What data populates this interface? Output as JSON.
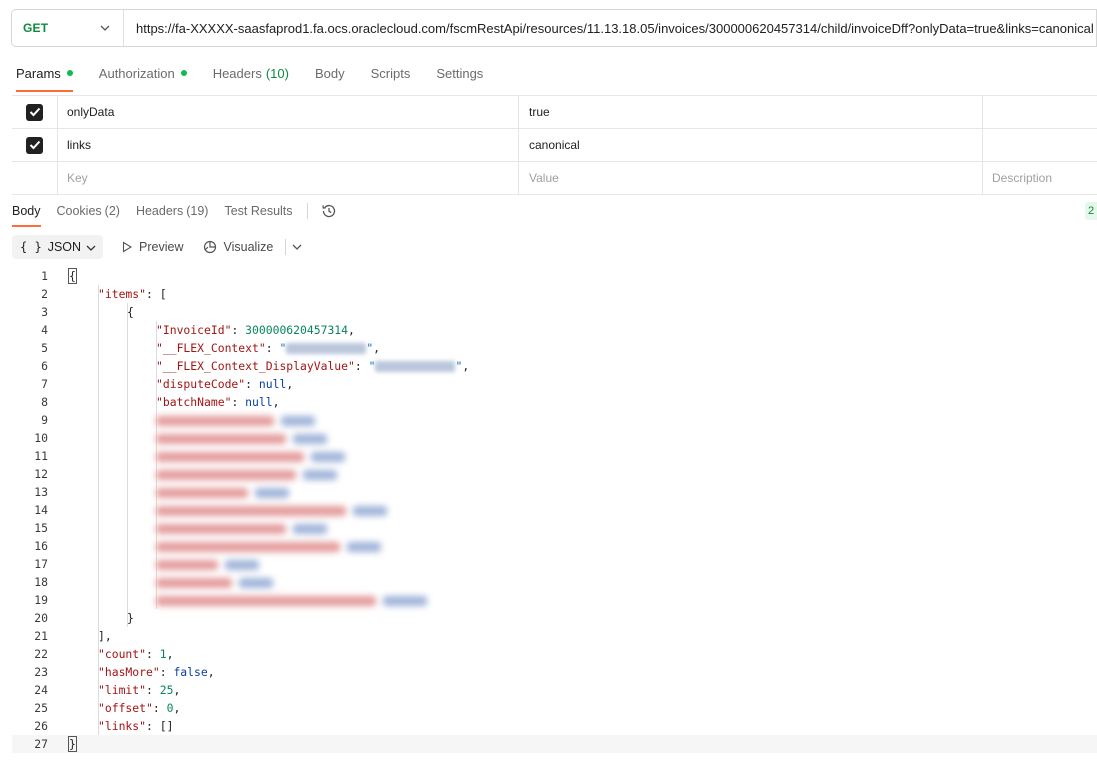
{
  "request": {
    "method": "GET",
    "url": "https://fa-XXXXX-saasfaprod1.fa.ocs.oraclecloud.com/fscmRestApi/resources/11.13.18.05/invoices/300000620457314/child/invoiceDff?onlyData=true&links=canonical"
  },
  "request_tabs": {
    "params": "Params",
    "authorization": "Authorization",
    "headers": "Headers",
    "headers_count": "(10)",
    "body": "Body",
    "scripts": "Scripts",
    "settings": "Settings"
  },
  "params": {
    "rows": [
      {
        "key": "onlyData",
        "value": "true",
        "checked": true
      },
      {
        "key": "links",
        "value": "canonical",
        "checked": true
      }
    ],
    "placeholder_key": "Key",
    "placeholder_value": "Value",
    "placeholder_description": "Description"
  },
  "response_tabs": {
    "body": "Body",
    "cookies": "Cookies",
    "cookies_count": "(2)",
    "headers": "Headers",
    "headers_count": "(19)",
    "test_results": "Test Results",
    "status_partial": "2"
  },
  "response_toolbar": {
    "format": "JSON",
    "preview": "Preview",
    "visualize": "Visualize"
  },
  "response_body": {
    "line_numbers": [
      "1",
      "2",
      "3",
      "4",
      "5",
      "6",
      "7",
      "8",
      "9",
      "10",
      "11",
      "12",
      "13",
      "14",
      "15",
      "16",
      "17",
      "18",
      "19",
      "20",
      "21",
      "22",
      "23",
      "24",
      "25",
      "26",
      "27"
    ],
    "items_key": "\"items\"",
    "invoice_id_key": "\"InvoiceId\"",
    "invoice_id_value": "300000620457314",
    "flex_context_key": "\"__FLEX_Context\"",
    "flex_context_display_key": "\"__FLEX_Context_DisplayValue\"",
    "dispute_code_key": "\"disputeCode\"",
    "batch_name_key": "\"batchName\"",
    "null_value": "null",
    "count_key": "\"count\"",
    "count_value": "1",
    "has_more_key": "\"hasMore\"",
    "has_more_value": "false",
    "limit_key": "\"limit\"",
    "limit_value": "25",
    "offset_key": "\"offset\"",
    "offset_value": "0",
    "links_key": "\"links\"",
    "links_value": "[]"
  },
  "colors": {
    "method_get": "#0e8a3e",
    "active_tab_underline": "#ff6c37",
    "status_dot": "#0cbb52",
    "json_key": "#a31515",
    "json_number": "#098658",
    "json_keyword": "#0b3fa0"
  }
}
